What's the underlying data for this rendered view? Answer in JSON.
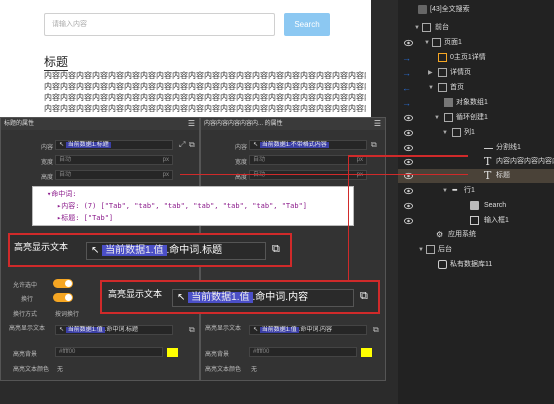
{
  "preview": {
    "search_placeholder": "请输入内容",
    "search_button": "Search",
    "heading": "标题",
    "content_lines": [
      "内容内容内容内容内容内容内容内容内容内容内容内容内容内容内容内容内容内容内容内容内容",
      "内容内容内容内容内容内容内容内容内容内容内容内容内容内容内容内容内容内容内容内容内容",
      "内容内容内容内容内容内容内容内容内容内容内容内容内容内容内容内容内容内容内容内容内容",
      "内容内容内容内容内容内容内容内容内容内容内容内容内容内容内容内容内容内容内容内容内容"
    ]
  },
  "tree": {
    "items": [
      {
        "label": "[43]全文搜索",
        "icon": "component-icon"
      },
      {
        "label": "前台",
        "icon": "folder-icon"
      },
      {
        "label": "页面1",
        "icon": "page-icon"
      },
      {
        "label": "0主页1详情",
        "icon": "component-icon"
      },
      {
        "label": "详情页",
        "icon": "page-icon"
      },
      {
        "label": "首页",
        "icon": "page-icon"
      },
      {
        "label": "对象数组1",
        "icon": "data-icon"
      },
      {
        "label": "循环创建1",
        "icon": "loop-icon"
      },
      {
        "label": "列1",
        "icon": "column-icon"
      },
      {
        "label": "分割线1",
        "icon": "divider-icon"
      },
      {
        "label": "内容内容内容内容内容",
        "icon": "text-icon"
      },
      {
        "label": "标题",
        "icon": "text-icon"
      },
      {
        "label": "行1",
        "icon": "row-icon"
      },
      {
        "label": "Search",
        "icon": "button-icon"
      },
      {
        "label": "输入框1",
        "icon": "input-icon"
      },
      {
        "label": "应用系统",
        "icon": "gear-icon"
      },
      {
        "label": "后台",
        "icon": "folder-icon"
      },
      {
        "label": "私有数据库11",
        "icon": "database-icon"
      }
    ]
  },
  "panel_left": {
    "title": "标题的属性",
    "rows": [
      {
        "label": "内容",
        "tag": "当前数据1.标题"
      },
      {
        "label": "宽度",
        "value": "自动",
        "unit": "px"
      },
      {
        "label": "高度",
        "value": "自动",
        "unit": "px"
      }
    ],
    "lower": {
      "allow_copy_label": "允许选中",
      "wrap_label": "换行",
      "wrap_mode_label": "换行方式",
      "wrap_mode_value": "按词换行",
      "hl_text_label": "高亮显示文本",
      "hl_text_tag": "当前数据1.值",
      "hl_text_rest": ".命中词.标题",
      "hl_bg_label": "高亮背景",
      "hl_bg_value": "#ffff00",
      "hl_color_label": "高亮文本颜色",
      "hl_color_value": "无"
    }
  },
  "panel_right": {
    "title": "内容内容内容内容内... 的属性",
    "rows": [
      {
        "label": "内容",
        "tag": "当前数据1.不带格式内容"
      },
      {
        "label": "宽度",
        "value": "自动",
        "unit": "px"
      },
      {
        "label": "高度",
        "value": "自动",
        "unit": "px"
      }
    ],
    "lower": {
      "hl_text_label": "高亮显示文本",
      "hl_text_tag": "当前数据1.值",
      "hl_text_rest": ".命中词.内容",
      "hl_bg_label": "高亮背景",
      "hl_bg_value": "#ffff00",
      "hl_color_label": "高亮文本颜色",
      "hl_color_value": "无"
    }
  },
  "tooltip": {
    "root": "▾命中词:",
    "content_line": "▸内容: (7) [\"Tab\", \"tab\", \"tab\", \"tab\", \"tab\", \"tab\", \"Tab\"]",
    "title_line": "▸标题: [\"Tab\"]"
  },
  "highlight_left": {
    "label": "高亮显示文本",
    "tag": "当前数据1.值",
    "rest": ".命中词.标题"
  },
  "highlight_right": {
    "label": "高亮显示文本",
    "tag": "当前数据1.值",
    "rest": ".命中词.内容"
  },
  "colors": {
    "accent": "#d02a2a",
    "tag": "#3b3fa6",
    "toggle": "#f5a623",
    "highlight_bg": "#ffff00"
  }
}
